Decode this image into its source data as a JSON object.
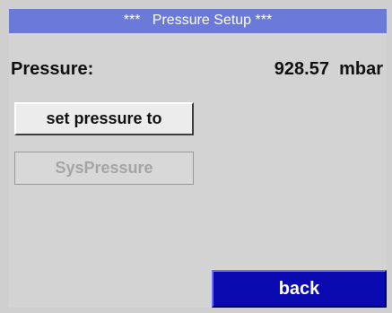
{
  "window": {
    "title": "***   Pressure Setup ***"
  },
  "pressure": {
    "label": "Pressure:",
    "value": "928.57  mbar"
  },
  "buttons": {
    "set_pressure_label": "set pressure to",
    "syspressure_label": "SysPressure",
    "back_label": "back"
  },
  "colors": {
    "title_bar": "#6b79d8",
    "background": "#d3d3d3",
    "back_button": "#0a0ab0",
    "disabled_text": "#a5a5a5"
  }
}
